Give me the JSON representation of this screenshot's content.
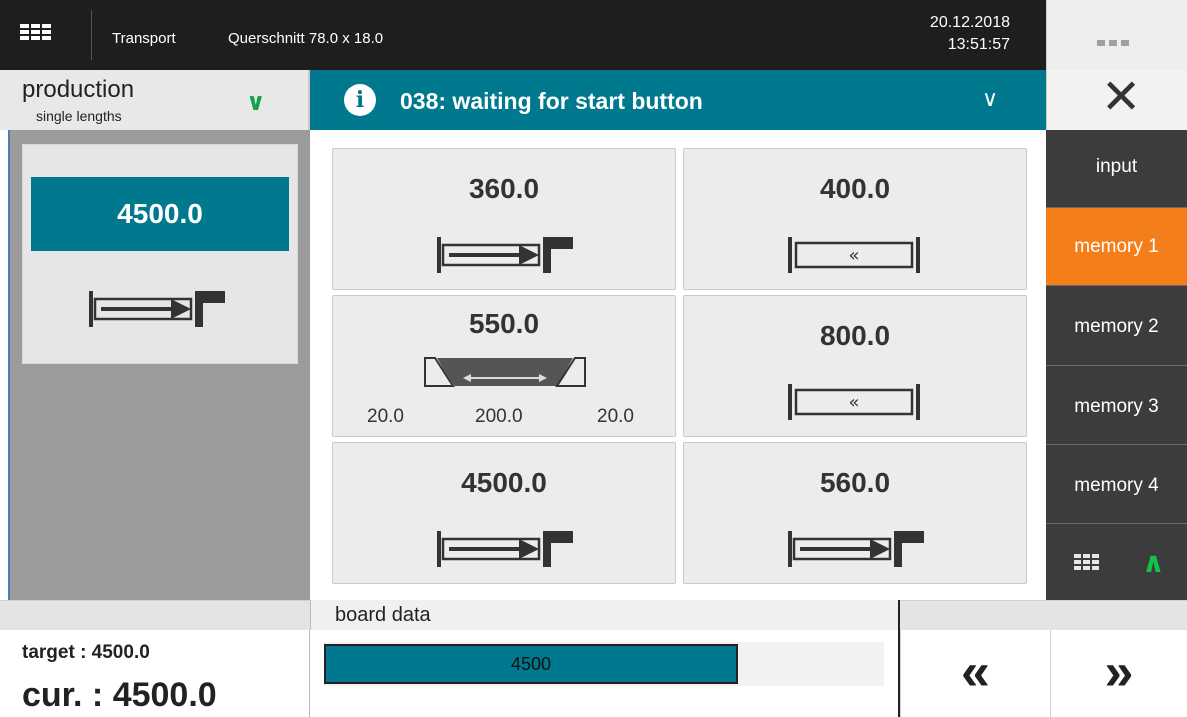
{
  "topbar": {
    "title": "Transport",
    "section": "Querschnitt 78.0 x 18.0",
    "date": "20.12.2018",
    "time": "13:51:57"
  },
  "mode": {
    "title": "production",
    "subtitle": "single lengths"
  },
  "status": {
    "message": "038: waiting for start button"
  },
  "left_panel": {
    "value": "4500.0",
    "icon": "push-arrow-icon"
  },
  "grid": {
    "cells": [
      {
        "value": "360.0",
        "icon": "push-arrow-icon"
      },
      {
        "value": "400.0",
        "icon": "window-icon",
        "symbol": "«"
      },
      {
        "value": "550.0",
        "icon": "trapezoid-icon",
        "labels": [
          "20.0",
          "200.0",
          "20.0"
        ]
      },
      {
        "value": "800.0",
        "icon": "window-icon",
        "symbol": "«"
      },
      {
        "value": "4500.0",
        "icon": "push-arrow-icon"
      },
      {
        "value": "560.0",
        "icon": "push-arrow-icon"
      }
    ]
  },
  "sidebar": {
    "items": [
      {
        "label": "input",
        "active": false
      },
      {
        "label": "memory 1",
        "active": true
      },
      {
        "label": "memory 2",
        "active": false
      },
      {
        "label": "memory 3",
        "active": false
      },
      {
        "label": "memory 4",
        "active": false
      }
    ]
  },
  "bottom": {
    "board_label": "board data",
    "target": "target : 4500.0",
    "current": "cur. : 4500.0",
    "board_value": "4500",
    "board_fill": 0.74,
    "prev_label": "«",
    "next_label": "»"
  },
  "colors": {
    "accent": "#00788d",
    "active": "#f47f1a",
    "ok": "#14a14a",
    "dark": "#1e1e1e"
  }
}
